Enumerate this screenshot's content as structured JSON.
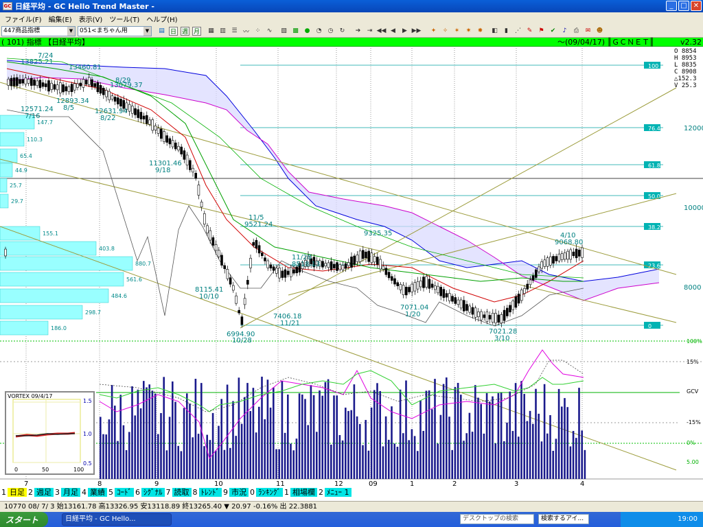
{
  "window": {
    "title": "日経平均 - GC Hello Trend Master -",
    "app_icon": "GC",
    "min": "_",
    "max": "□",
    "close": "✕"
  },
  "menu": [
    "ファイル(F)",
    "編集(E)",
    "表示(V)",
    "ツール(T)",
    "ヘルプ(H)"
  ],
  "toolbar": {
    "category_select": "447商品指標",
    "layout_select": "051<まちゃん用",
    "period_buttons": [
      "日",
      "週",
      "月"
    ]
  },
  "chart_header": {
    "label": "( 101) 指標 【日経平均】",
    "right": "～(09/04/17) ║ＧＣＮＥＴ║",
    "version": "v2.32"
  },
  "ohlc": {
    "o": "O  8854",
    "h": "H  8953",
    "l": "L  8835",
    "c": "C  8908",
    "chg": "△152.3",
    "v": "V  25.3"
  },
  "price_axis": [
    "12000",
    "10000",
    "8000"
  ],
  "fib_levels": [
    "100",
    "76.4",
    "61.8",
    "50.0",
    "38.2",
    "23.6",
    "0"
  ],
  "osc_axis": [
    "100%",
    "15%",
    "GCV",
    "-15%",
    "0%",
    "5.00"
  ],
  "month_labels": [
    "7",
    "8",
    "9",
    "10",
    "11",
    "12",
    "09",
    "1",
    "2",
    "3",
    "4"
  ],
  "annotations": [
    {
      "text": "13825.21"
    },
    {
      "text": "7/24"
    },
    {
      "text": "13460.81"
    },
    {
      "text": "8/29"
    },
    {
      "text": "13079.37"
    },
    {
      "text": "12571.24"
    },
    {
      "text": "7/16"
    },
    {
      "text": "12893.34"
    },
    {
      "text": "8/5"
    },
    {
      "text": "12631.94"
    },
    {
      "text": "8/22"
    },
    {
      "text": "11301.46"
    },
    {
      "text": "9/18"
    },
    {
      "text": "11/5"
    },
    {
      "text": "9521.24"
    },
    {
      "text": "8115.41"
    },
    {
      "text": "10/10"
    },
    {
      "text": "11/28"
    },
    {
      "text": "8518.13"
    },
    {
      "text": "9325.35"
    },
    {
      "text": "7406.18"
    },
    {
      "text": "11/21"
    },
    {
      "text": "6994.90"
    },
    {
      "text": "10/28"
    },
    {
      "text": "7071.04"
    },
    {
      "text": "1/20"
    },
    {
      "text": "4/10"
    },
    {
      "text": "9068.80"
    },
    {
      "text": "7021.28"
    },
    {
      "text": "3/10"
    }
  ],
  "volume_profile": [
    "147.7",
    "110.3",
    "65.4",
    "44.9",
    "25.7",
    "29.7",
    "155.1",
    "403.8",
    "880.7",
    "561.6",
    "484.6",
    "298.7",
    "186.0"
  ],
  "vortex": {
    "title": "VORTEX 09/4/17",
    "yticks": [
      "1.5",
      "1.0",
      "0.5"
    ],
    "xticks": [
      "0",
      "50",
      "100"
    ]
  },
  "fkeys": [
    {
      "n": "1",
      "t": "日足",
      "sel": true
    },
    {
      "n": "2",
      "t": "週足"
    },
    {
      "n": "3",
      "t": "月足"
    },
    {
      "n": "4",
      "t": "業績"
    },
    {
      "n": "5",
      "t": "ｺｰﾄﾞ"
    },
    {
      "n": "6",
      "t": "ｼｸﾞﾅﾙ"
    },
    {
      "n": "7",
      "t": "読取"
    },
    {
      "n": "8",
      "t": "ﾄﾚﾝﾄﾞ"
    },
    {
      "n": "9",
      "t": "市況"
    },
    {
      "n": "0",
      "t": "ﾗﾝｷﾝｸﾞ"
    },
    {
      "n": "1",
      "t": "相場欄"
    },
    {
      "n": "2",
      "t": "ﾒﾆｭｰ 1"
    }
  ],
  "status": "10770 08/ 7/ 3 始13161.78 高13326.95 安13118.89 終13265.40 ▼  20.97  -0.16% 出  22.3881",
  "taskbar": {
    "start": "スタート",
    "task": "日経平均 - GC Hello...",
    "search": "デスクトップの検索",
    "search2": "検索するアイ...",
    "clock": "19:00"
  },
  "colors": {
    "fib": "#00a0a0",
    "kumo": "#0000ff",
    "ma_red": "#d00000",
    "ma_green": "#00a000",
    "trend": "#9c9c3c",
    "volume": "#1a1a8c"
  },
  "chart_data": [
    {
      "type": "line",
      "title": "日経平均",
      "x": [
        "7/16",
        "7/24",
        "8/5",
        "8/22",
        "8/29",
        "9/18",
        "10/10",
        "10/28",
        "11/5",
        "11/21",
        "11/28",
        "1/20",
        "3/10",
        "4/10",
        "4/17"
      ],
      "series": [
        {
          "name": "close",
          "values": [
            12571,
            13825,
            12893,
            12632,
            13079,
            11301,
            8115,
            6995,
            9521,
            7406,
            8518,
            7071,
            7021,
            9068,
            8908
          ]
        }
      ],
      "ylabel": "",
      "ylim": [
        6500,
        14000
      ]
    }
  ]
}
